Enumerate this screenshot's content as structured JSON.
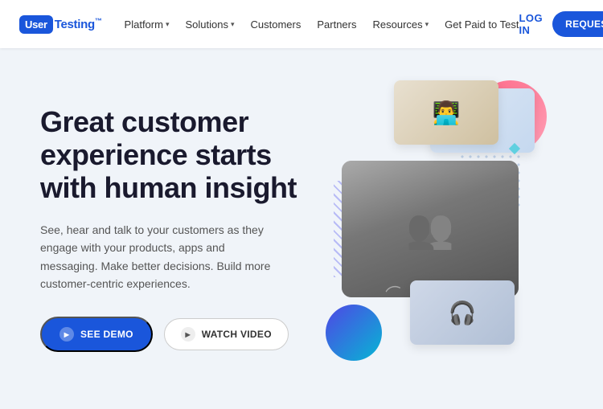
{
  "brand": {
    "logo_box": "User",
    "logo_text": "Testing",
    "logo_trademark": "™"
  },
  "nav": {
    "links": [
      {
        "label": "Platform",
        "has_dropdown": true
      },
      {
        "label": "Solutions",
        "has_dropdown": true
      },
      {
        "label": "Customers",
        "has_dropdown": false
      },
      {
        "label": "Partners",
        "has_dropdown": false
      },
      {
        "label": "Resources",
        "has_dropdown": true
      },
      {
        "label": "Get Paid to Test",
        "has_dropdown": false
      }
    ],
    "login_label": "LOG IN",
    "trial_label": "REQUEST TRIAL"
  },
  "hero": {
    "title": "Great customer experience starts with human insight",
    "description": "See, hear and talk to your customers as they engage with your products, apps and messaging. Make better decisions. Build more customer-centric experiences.",
    "btn_demo": "SEE DEMO",
    "btn_video": "WATCH VIDEO"
  }
}
